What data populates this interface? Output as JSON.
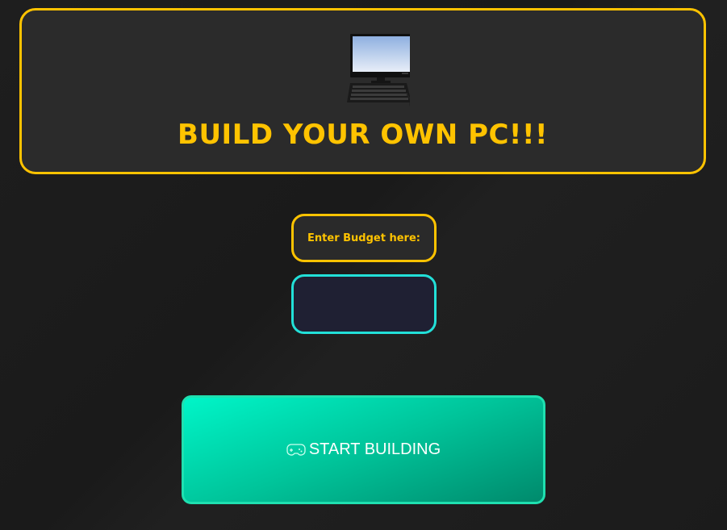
{
  "header": {
    "icon": "desktop-computer-icon",
    "title": "BUILD YOUR OWN PC!!!"
  },
  "budget": {
    "label": "Enter Budget here:",
    "input_value": "",
    "input_placeholder": ""
  },
  "start_button": {
    "icon": "gamepad-icon",
    "label": "START BUILDING"
  },
  "colors": {
    "accent_yellow": "#ffc300",
    "accent_cyan": "#22e0d8",
    "button_green": "#00c49a",
    "background": "#1c1c1c",
    "card": "#2b2b2b"
  }
}
